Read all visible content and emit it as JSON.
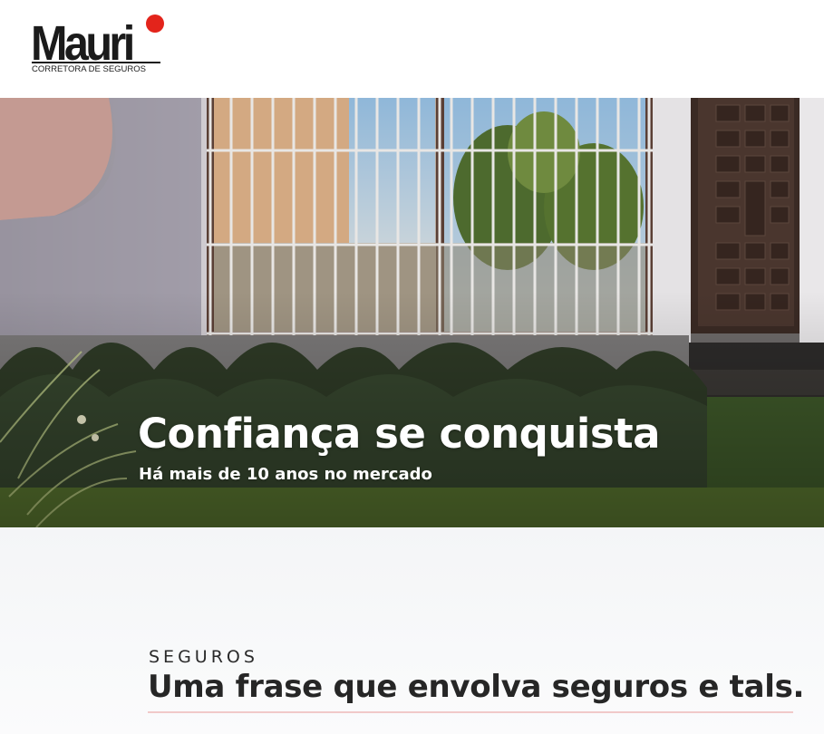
{
  "header": {
    "logo": {
      "wordmark": "Mauri",
      "tagline": "CORRETORA DE SEGUROS",
      "dot_color": "#e3241b"
    }
  },
  "hero": {
    "title": "Confiança se conquista",
    "subtitle": "Há mais de 10 anos no mercado"
  },
  "section": {
    "eyebrow": "SEGUROS",
    "headline": "Uma frase que envolva seguros e tals.",
    "underline_color": "#f1c9c9"
  }
}
